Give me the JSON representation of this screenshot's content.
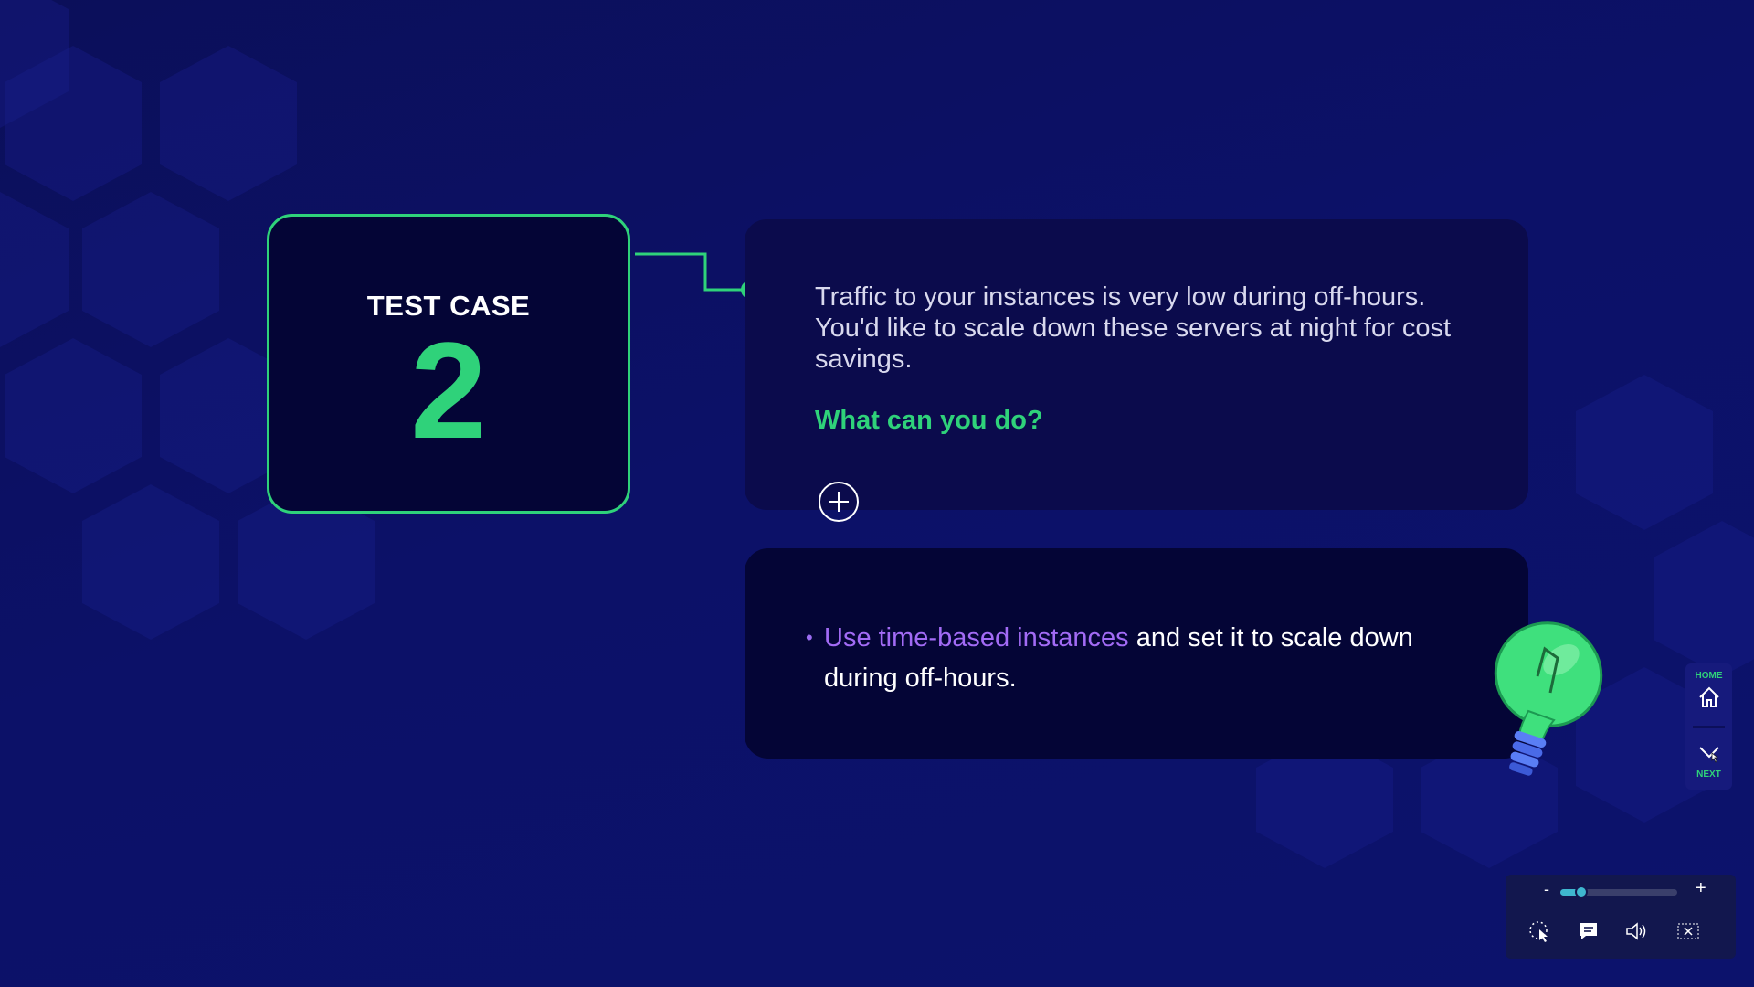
{
  "case_card": {
    "title": "TEST CASE",
    "number": "2"
  },
  "question": {
    "text": "Traffic to your instances is very low during off-hours. You'd like to scale down these servers at night for cost savings.",
    "prompt": "What can you do?"
  },
  "answer": {
    "bullet": "•",
    "link_text": "Use time-based instances",
    "rest_text": " and set it to scale down during off-hours."
  },
  "side_nav": {
    "home_label": "HOME",
    "next_label": "NEXT"
  },
  "player": {
    "zoom_minus": "-",
    "zoom_plus": "+",
    "zoom_level": 0.18,
    "icons": [
      "pointer-icon",
      "captions-icon",
      "volume-icon",
      "close-icon"
    ]
  },
  "colors": {
    "accent": "#2fd27a",
    "link": "#a26bf5",
    "panel": "#0b0b4c",
    "dark_panel": "#040536"
  }
}
